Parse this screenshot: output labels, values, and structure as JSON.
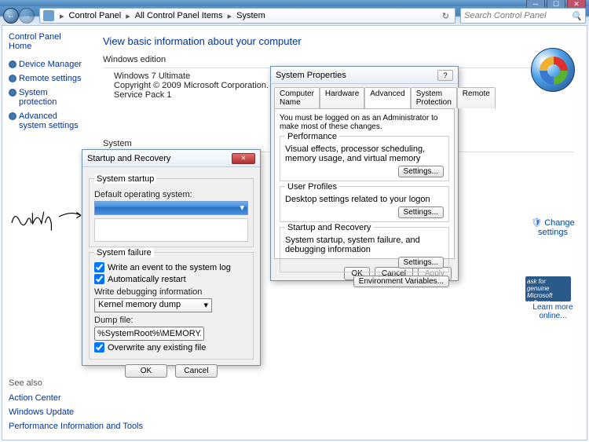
{
  "window": {
    "min": "─",
    "max": "☐",
    "close": "✕"
  },
  "nav": {
    "back_glyph": "←",
    "fwd_glyph": "→",
    "breadcrumb": [
      "Control Panel",
      "All Control Panel Items",
      "System"
    ],
    "search_placeholder": "Search Control Panel",
    "refresh_glyph": "↻"
  },
  "sidebar": {
    "home": "Control Panel Home",
    "links": [
      "Device Manager",
      "Remote settings",
      "System protection",
      "Advanced system settings"
    ],
    "seealso_hdr": "See also",
    "seealso": [
      "Action Center",
      "Windows Update",
      "Performance Information and Tools"
    ]
  },
  "main": {
    "title": "View basic information about your computer",
    "edition_hdr": "Windows edition",
    "edition_name": "Windows 7 Ultimate",
    "copyright": "Copyright © 2009 Microsoft Corporation.  All rights reserved.",
    "sp": "Service Pack 1",
    "system_hdr": "System",
    "change": "Change settings",
    "learn_more": "Learn more online...",
    "genuine": "ask for genuine Microsoft software"
  },
  "sysprops": {
    "title": "System Properties",
    "tabs": [
      "Computer Name",
      "Hardware",
      "Advanced",
      "System Protection",
      "Remote"
    ],
    "note": "You must be logged on as an Administrator to make most of these changes.",
    "perf": {
      "legend": "Performance",
      "body": "Visual effects, processor scheduling, memory usage, and virtual memory",
      "btn": "Settings..."
    },
    "userprof": {
      "legend": "User Profiles",
      "body": "Desktop settings related to your logon",
      "btn": "Settings..."
    },
    "startup": {
      "legend": "Startup and Recovery",
      "body": "System startup, system failure, and debugging information",
      "btn": "Settings..."
    },
    "envvar": "Environment Variables...",
    "ok": "OK",
    "cancel": "Cancel",
    "apply": "Apply"
  },
  "startrec": {
    "title": "Startup and Recovery",
    "close": "✕",
    "grp_startup": "System startup",
    "def_os_lbl": "Default operating system:",
    "grp_failure": "System failure",
    "cb_writeevent": "Write an event to the system log",
    "cb_autorestart": "Automatically restart",
    "dbg_lbl": "Write debugging information",
    "dbg_value": "Kernel memory dump",
    "dump_lbl": "Dump file:",
    "dump_value": "%SystemRoot%\\MEMORY.DMP",
    "cb_overwrite": "Overwrite any existing file",
    "ok": "OK",
    "cancel": "Cancel"
  },
  "handwriting": "Empty"
}
